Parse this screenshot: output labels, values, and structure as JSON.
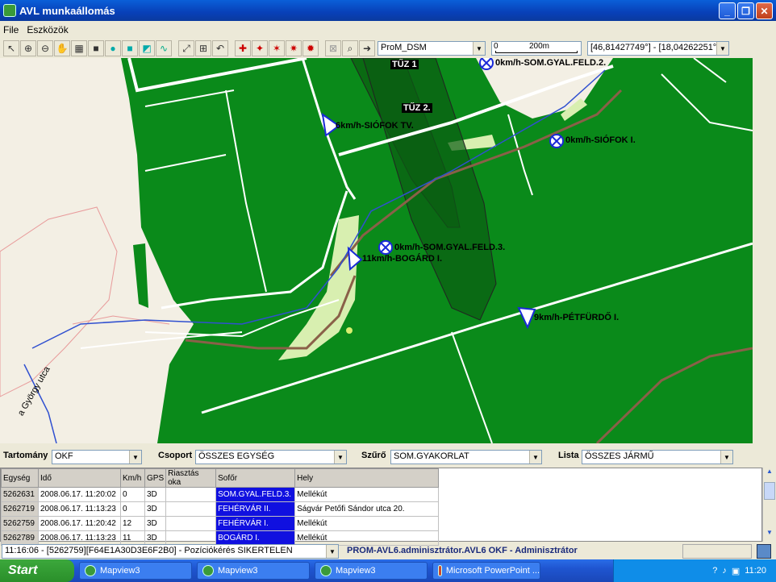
{
  "window": {
    "title": "AVL munkaállomás"
  },
  "menu": {
    "file": "File",
    "tools": "Eszközök"
  },
  "toolbar": {
    "layer_select": "ProM_DSM",
    "scale_zero": "0",
    "scale_label": "200m",
    "coords": "[46,81427749°] - [18,04262251°]"
  },
  "map": {
    "zones": [
      "TŰZ 1",
      "TŰZ 2."
    ],
    "units": [
      {
        "label": "0km/h-SOM.GYAL.FELD.2.",
        "icon": "stopped-unit-icon"
      },
      {
        "label": "6km/h-SIÓFOK TV.",
        "icon": "moving-unit-icon"
      },
      {
        "label": "0km/h-SIÓFOK I.",
        "icon": "stopped-unit-icon"
      },
      {
        "label": "0km/h-SOM.GYAL.FELD.3.",
        "icon": "stopped-unit-icon"
      },
      {
        "label": "11km/h-BOGÁRD I.",
        "icon": "moving-unit-icon"
      },
      {
        "label": "9km/h-PÉTFÜRDŐ I.",
        "icon": "moving-unit-icon"
      }
    ],
    "street": "a György utca"
  },
  "filters": {
    "territory_label": "Tartomány",
    "territory_value": "OKF",
    "group_label": "Csoport",
    "group_value": "ÖSSZES EGYSÉG",
    "filter_label": "Szűrő",
    "filter_value": "SOM.GYAKORLAT",
    "list_label": "Lista",
    "list_value": "ÖSSZES JÁRMŰ"
  },
  "table": {
    "columns": [
      "Egység",
      "Idő",
      "Km/h",
      "GPS",
      "Riasztás oka",
      "Sofőr",
      "Hely"
    ],
    "rows": [
      [
        "5262631",
        "2008.06.17. 11:20:02",
        "0",
        "3D",
        "",
        "SOM.GYAL.FELD.3.",
        "Mellékút"
      ],
      [
        "5262719",
        "2008.06.17. 11:13:23",
        "0",
        "3D",
        "",
        "FEHÉRVÁR II.",
        "Ságvár Petőfi Sándor utca 20."
      ],
      [
        "5262759",
        "2008.06.17. 11:20:42",
        "12",
        "3D",
        "",
        "FEHÉRVÁR I.",
        "Mellékút"
      ],
      [
        "5262789",
        "2008.06.17. 11:13:23",
        "11",
        "3D",
        "",
        "BOGÁRD I.",
        "Mellékút"
      ]
    ]
  },
  "status": {
    "log": "11:16:06 - [5262759][F64E1A30D3E6F2B0] - Pozíciókérés SIKERTELEN",
    "user": "PROM-AVL6.adminisztrátor.AVL6 OKF - Adminisztrátor"
  },
  "taskbar": {
    "start": "Start",
    "tasks": [
      "Mapview3",
      "Mapview3",
      "Mapview3",
      "Microsoft PowerPoint ..."
    ],
    "clock": "11:20"
  },
  "colors": {
    "forest": "#0a8a1a",
    "title_blue": "#0a5fd8",
    "driver_highlight": "#1010e0"
  }
}
